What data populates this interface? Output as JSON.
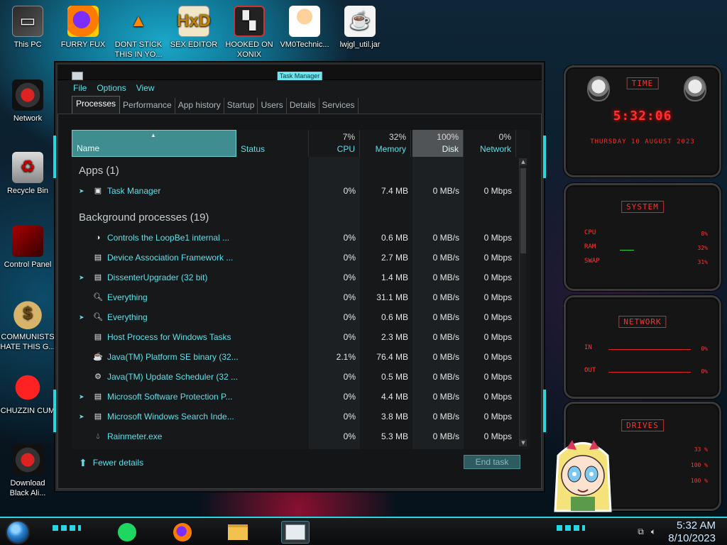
{
  "desktop": {
    "icons": [
      {
        "label": "This PC",
        "icon": "computer-icon"
      },
      {
        "label": "FURRY FUX",
        "icon": "firefox-icon"
      },
      {
        "label": "DONT STICK THIS IN YO...",
        "icon": "vlc-icon"
      },
      {
        "label": "SEX EDITOR",
        "icon": "hxd-editor-icon"
      },
      {
        "label": "HOOKED ON XONIX",
        "icon": "xonix-icon"
      },
      {
        "label": "VM0Technic...",
        "icon": "doctor-icon"
      },
      {
        "label": "lwjgl_util.jar",
        "icon": "java-jar-icon"
      },
      {
        "label": "Network",
        "icon": "network-icon"
      },
      {
        "label": "Recycle Bin",
        "icon": "recycle-bin-icon"
      },
      {
        "label": "Control Panel",
        "icon": "control-panel-icon"
      },
      {
        "label": "COMMUNISTS HATE THIS G...",
        "icon": "money-bag-icon"
      },
      {
        "label": "CHUZZIN CUM",
        "icon": "chuzzle-icon"
      },
      {
        "label": "Download Black Ali...",
        "icon": "alienware-icon"
      }
    ]
  },
  "task_manager": {
    "title": "Task Manager",
    "menu": [
      "File",
      "Options",
      "View"
    ],
    "tabs": [
      "Processes",
      "Performance",
      "App history",
      "Startup",
      "Users",
      "Details",
      "Services"
    ],
    "active_tab": "Processes",
    "columns": {
      "name": "Name",
      "status": "Status",
      "cpu": {
        "label": "CPU",
        "pct": "7%"
      },
      "memory": {
        "label": "Memory",
        "pct": "32%"
      },
      "disk": {
        "label": "Disk",
        "pct": "100%"
      },
      "network": {
        "label": "Network",
        "pct": "0%"
      }
    },
    "groups": [
      {
        "title": "Apps (1)",
        "rows": [
          {
            "name": "Task Manager",
            "expandable": true,
            "icon": "task-manager-icon",
            "cpu": "0%",
            "memory": "7.4 MB",
            "disk": "0 MB/s",
            "network": "0 Mbps"
          }
        ]
      },
      {
        "title": "Background processes (19)",
        "rows": [
          {
            "name": "Controls the LoopBe1 internal ...",
            "expandable": false,
            "icon": "loopbe-icon",
            "cpu": "0%",
            "memory": "0.6 MB",
            "disk": "0 MB/s",
            "network": "0 Mbps"
          },
          {
            "name": "Device Association Framework ...",
            "expandable": false,
            "icon": "window-icon",
            "cpu": "0%",
            "memory": "2.7 MB",
            "disk": "0 MB/s",
            "network": "0 Mbps"
          },
          {
            "name": "DissenterUpgrader (32 bit)",
            "expandable": true,
            "icon": "window-icon",
            "cpu": "0%",
            "memory": "1.4 MB",
            "disk": "0 MB/s",
            "network": "0 Mbps"
          },
          {
            "name": "Everything",
            "expandable": false,
            "icon": "magnifier-icon",
            "cpu": "0%",
            "memory": "31.1 MB",
            "disk": "0 MB/s",
            "network": "0 Mbps"
          },
          {
            "name": "Everything",
            "expandable": true,
            "icon": "magnifier-icon",
            "cpu": "0%",
            "memory": "0.6 MB",
            "disk": "0 MB/s",
            "network": "0 Mbps"
          },
          {
            "name": "Host Process for Windows Tasks",
            "expandable": false,
            "icon": "window-icon",
            "cpu": "0%",
            "memory": "2.3 MB",
            "disk": "0 MB/s",
            "network": "0 Mbps"
          },
          {
            "name": "Java(TM) Platform SE binary (32...",
            "expandable": false,
            "icon": "java-icon",
            "cpu": "2.1%",
            "memory": "76.4 MB",
            "disk": "0 MB/s",
            "network": "0 Mbps"
          },
          {
            "name": "Java(TM) Update Scheduler (32 ...",
            "expandable": false,
            "icon": "java-update-icon",
            "cpu": "0%",
            "memory": "0.5 MB",
            "disk": "0 MB/s",
            "network": "0 Mbps"
          },
          {
            "name": "Microsoft Software Protection P...",
            "expandable": true,
            "icon": "window-icon",
            "cpu": "0%",
            "memory": "4.4 MB",
            "disk": "0 MB/s",
            "network": "0 Mbps"
          },
          {
            "name": "Microsoft Windows Search Inde...",
            "expandable": true,
            "icon": "window-icon",
            "cpu": "0%",
            "memory": "3.8 MB",
            "disk": "0 MB/s",
            "network": "0 Mbps"
          },
          {
            "name": "Rainmeter.exe",
            "expandable": false,
            "icon": "rainmeter-drop-icon",
            "cpu": "0%",
            "memory": "5.3 MB",
            "disk": "0 MB/s",
            "network": "0 Mbps"
          }
        ]
      }
    ],
    "footer": {
      "fewer_details": "Fewer details",
      "end_task": "End task"
    }
  },
  "widgets": {
    "time": {
      "title": "TIME",
      "clock": "5:32:06",
      "date": "THURSDAY 10 AUGUST 2023"
    },
    "system": {
      "title": "SYSTEM",
      "metrics": [
        {
          "label": "CPU",
          "value": "8%"
        },
        {
          "label": "RAM",
          "value": "32%"
        },
        {
          "label": "SWAP",
          "value": "31%"
        }
      ]
    },
    "network": {
      "title": "NETWORK",
      "metrics": [
        {
          "label": "IN",
          "value": "0%"
        },
        {
          "label": "OUT",
          "value": "0%"
        }
      ]
    },
    "drives": {
      "title": "DRIVES",
      "values": [
        "33 %",
        "100 %",
        "100 %"
      ]
    }
  },
  "taskbar": {
    "apps": [
      "spotify-icon",
      "firefox-icon",
      "file-explorer-icon",
      "task-manager-icon"
    ],
    "time": "5:32 AM",
    "date": "8/10/2023"
  },
  "colors": {
    "accent": "#5fe0ea",
    "widget_red": "#ff3131",
    "header_selected": "#3f8d8e"
  }
}
